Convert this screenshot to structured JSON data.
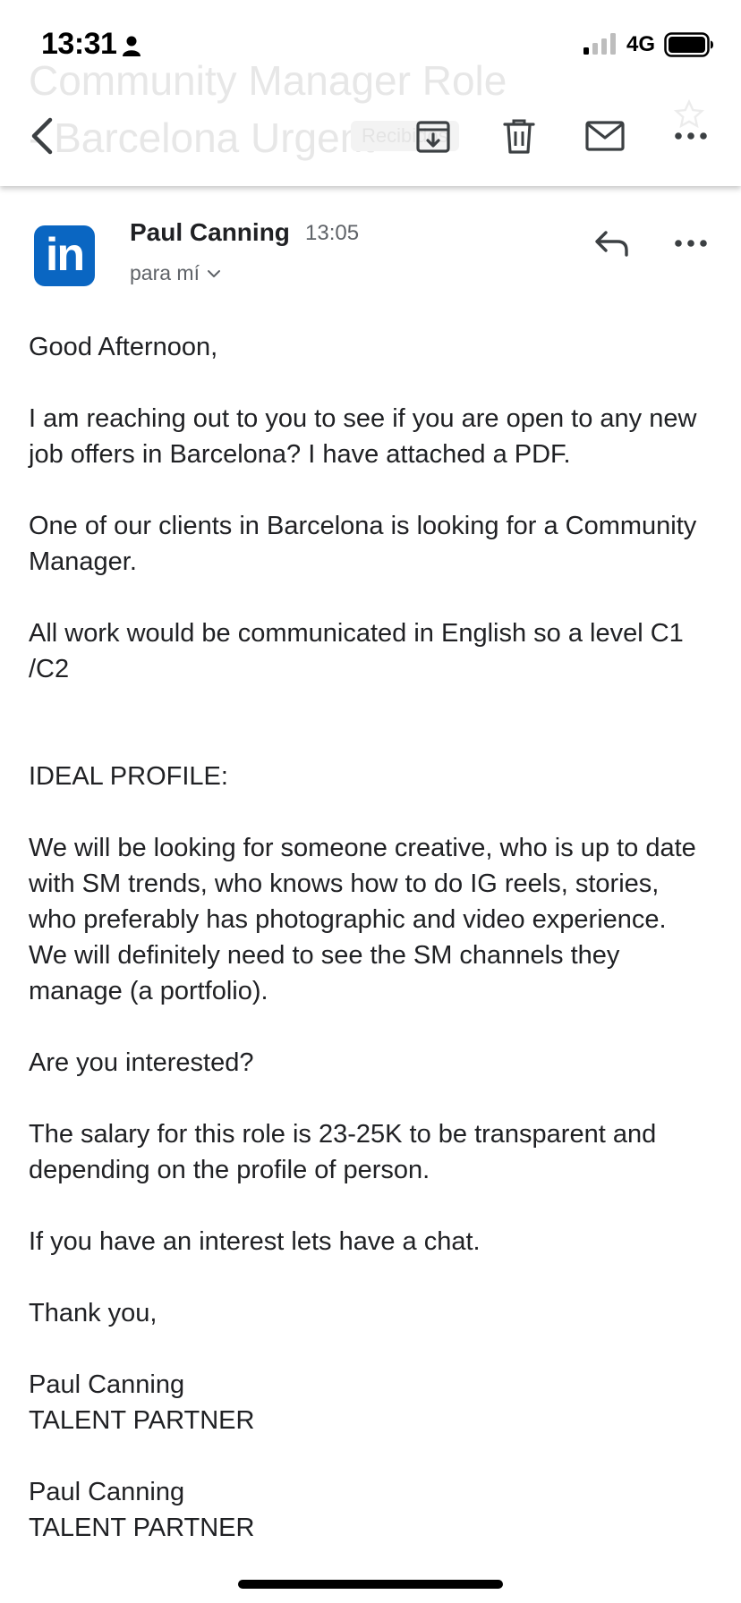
{
  "status_bar": {
    "time": "13:31",
    "network": "4G",
    "icons": [
      "person-icon",
      "signal-icon",
      "battery-icon"
    ]
  },
  "toolbar": {
    "subject_behind": "Community Manager Role - Barcelona Urgent",
    "inbox_badge": "Recibidos",
    "icons": [
      "back-icon",
      "archive-icon",
      "delete-icon",
      "mark-unread-icon",
      "more-icon",
      "star-icon"
    ]
  },
  "message": {
    "sender_name": "Paul Canning",
    "avatar_text": "in",
    "time": "13:05",
    "recipient": "para mí",
    "accent_color": "#0a66c2",
    "icons": [
      "linkedin-avatar",
      "reply-icon",
      "more-icon",
      "chevron-down-icon"
    ]
  },
  "body": {
    "greeting": "Good Afternoon,",
    "p1": "I am reaching out to you to see if you are open to any new job offers in Barcelona? I have attached a PDF.",
    "p2": "One of our clients in Barcelona is looking for a Community Manager.",
    "p3": "All work would be communicated in English so a level C1 /C2",
    "profile_heading": "IDEAL PROFILE:",
    "p4": "We will be looking for someone creative, who is up to date with SM trends, who knows how to do IG reels, stories, who preferably has photographic and video experience. We will definitely need to see the SM channels they manage (a portfolio).",
    "question": "Are you interested?",
    "salary": "The salary for this role is 23-25K to be transparent and depending on the profile of person.",
    "chat": "If you have an interest lets have a chat.",
    "closing": "Thank you,",
    "signature": [
      {
        "name": "Paul Canning",
        "title": "TALENT PARTNER"
      },
      {
        "name": "Paul Canning",
        "title": "TALENT PARTNER"
      }
    ]
  }
}
